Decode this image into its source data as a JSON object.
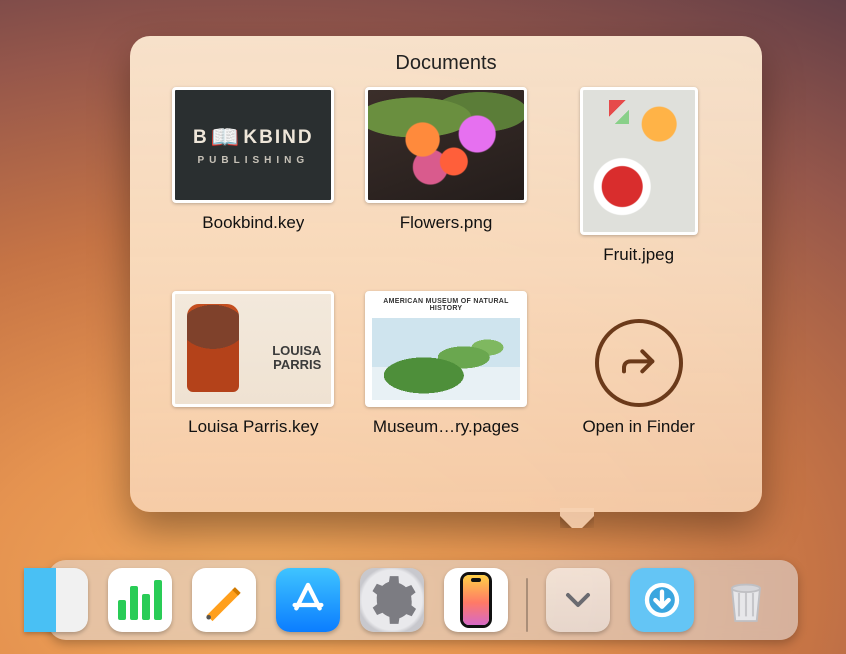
{
  "popup": {
    "title": "Documents",
    "items": [
      {
        "label": "Bookbind.key",
        "brand_top": "B",
        "brand_mid": "KBIND",
        "brand_sub": "PUBLISHING"
      },
      {
        "label": "Flowers.png"
      },
      {
        "label": "Fruit.jpeg"
      },
      {
        "label": "Louisa Parris.key"
      },
      {
        "label": "Museum…ry.pages",
        "museum_hdr": "AMERICAN MUSEUM OF NATURAL HISTORY"
      }
    ],
    "open_in_finder_label": "Open in Finder"
  },
  "dock": {
    "apps": [
      {
        "name": "finder"
      },
      {
        "name": "numbers"
      },
      {
        "name": "pages"
      },
      {
        "name": "appstore"
      },
      {
        "name": "settings"
      },
      {
        "name": "iphone-mirroring"
      }
    ],
    "right": [
      {
        "name": "documents-stack"
      },
      {
        "name": "downloads"
      },
      {
        "name": "trash"
      }
    ]
  }
}
